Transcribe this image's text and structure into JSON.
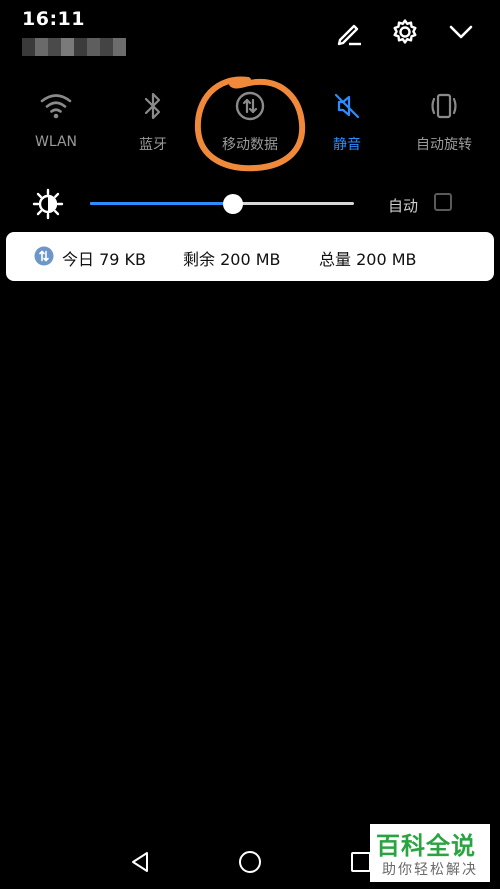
{
  "status_bar": {
    "time": "16:11"
  },
  "header": {
    "edit_icon": "pencil-edit-icon",
    "settings_icon": "gear-icon",
    "collapse_icon": "chevron-down-icon"
  },
  "toggles": [
    {
      "label": "WLAN",
      "icon": "wifi-icon",
      "active": false
    },
    {
      "label": "蓝牙",
      "icon": "bluetooth-icon",
      "active": false
    },
    {
      "label": "移动数据",
      "icon": "mobile-data-icon",
      "active": false
    },
    {
      "label": "静音",
      "icon": "mute-icon",
      "active": true
    },
    {
      "label": "自动旋转",
      "icon": "auto-rotate-icon",
      "active": false
    }
  ],
  "brightness": {
    "level": 0.54,
    "auto_label": "自动",
    "auto_checked": false
  },
  "data_usage": {
    "today": "今日 79 KB",
    "remaining": "剩余 200 MB",
    "total": "总量 200 MB"
  },
  "watermark": {
    "brand": "百科全说",
    "tagline": "助你轻松解决"
  },
  "colors": {
    "accent": "#2f8cff",
    "annotation": "#f08a3a",
    "inactive": "#9a9a9a",
    "background": "#000000"
  }
}
